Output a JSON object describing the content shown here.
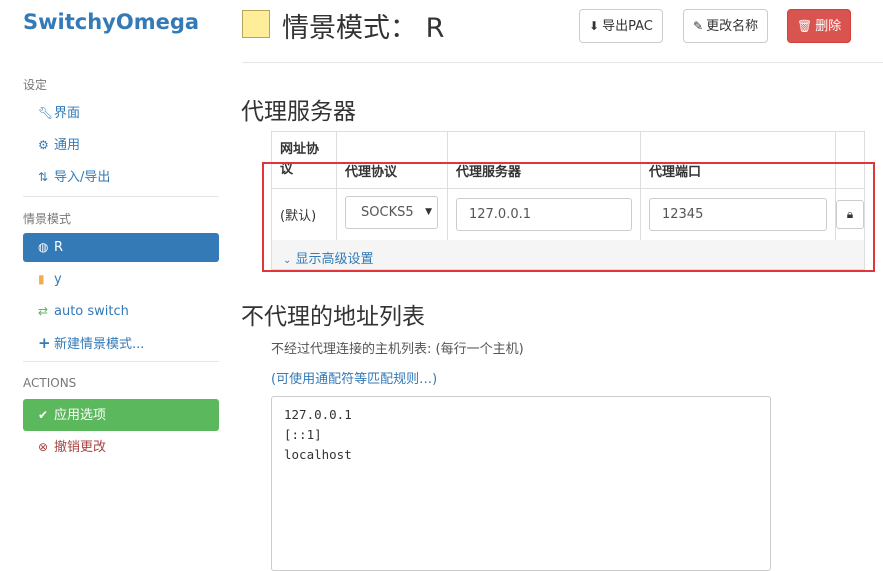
{
  "app": {
    "brand": "SwitchyOmega"
  },
  "sidebar": {
    "settings_title": "设定",
    "settings_items": [
      {
        "label": "界面",
        "icon": "wrench-icon"
      },
      {
        "label": "通用",
        "icon": "gear-icon"
      },
      {
        "label": "导入/导出",
        "icon": "import-export-icon"
      }
    ],
    "profiles_title": "情景模式",
    "profiles": [
      {
        "label": "R",
        "icon": "globe-icon",
        "active": true
      },
      {
        "label": "y",
        "icon": "file-icon"
      },
      {
        "label": "auto switch",
        "icon": "retweet-icon"
      },
      {
        "label": "新建情景模式...",
        "icon": "plus-icon"
      }
    ],
    "actions_title": "ACTIONS",
    "actions": [
      {
        "label": "应用选项",
        "icon": "check-circle-icon"
      },
      {
        "label": "撤销更改",
        "icon": "times-circle-icon"
      }
    ]
  },
  "header": {
    "title": "情景模式： R",
    "swatch_color": "#ffee99",
    "buttons": {
      "export_pac": "导出PAC",
      "rename": "更改名称",
      "delete": "删除"
    }
  },
  "proxy_section": {
    "title": "代理服务器",
    "columns": [
      "网址协议",
      "代理协议",
      "代理服务器",
      "代理端口",
      ""
    ],
    "row": {
      "scheme": "(默认)",
      "protocol": "SOCKS5",
      "server": "127.0.0.1",
      "port": "12345"
    },
    "advanced_link": "显示高级设置"
  },
  "bypass_section": {
    "title": "不代理的地址列表",
    "help": "不经过代理连接的主机列表: (每行一个主机)",
    "wildcard_link": "(可使用通配符等匹配规则…)",
    "entries": [
      "127.0.0.1",
      "[::1]",
      "localhost"
    ]
  }
}
